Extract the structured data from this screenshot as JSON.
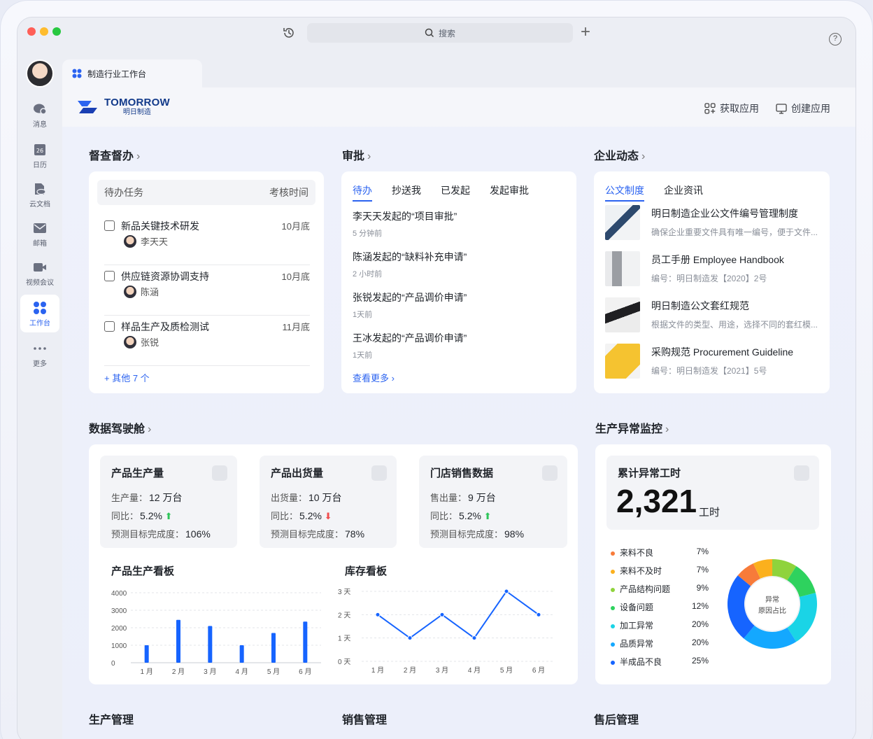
{
  "titlebar": {
    "search_placeholder": "搜索"
  },
  "rail": {
    "items": [
      {
        "label": "消息",
        "icon": "chat-icon"
      },
      {
        "label": "日历",
        "icon": "calendar-icon",
        "date": "26"
      },
      {
        "label": "云文档",
        "icon": "cloud-doc-icon"
      },
      {
        "label": "邮箱",
        "icon": "mail-icon"
      },
      {
        "label": "视频会议",
        "icon": "video-icon"
      },
      {
        "label": "工作台",
        "icon": "workspace-icon"
      },
      {
        "label": "更多",
        "icon": "more-icon"
      }
    ]
  },
  "tab": {
    "label": "制造行业工作台"
  },
  "header": {
    "logo_en": "TOMORROW",
    "logo_cn": "明日制造",
    "get_app": "获取应用",
    "create_app": "创建应用"
  },
  "supervision": {
    "title": "督查督办",
    "col_task": "待办任务",
    "col_time": "考核时间",
    "tasks": [
      {
        "name": "新品关键技术研发",
        "date": "10月底",
        "person": "李天天"
      },
      {
        "name": "供应链资源协调支持",
        "date": "10月底",
        "person": "陈涵"
      },
      {
        "name": "样品生产及质检测试",
        "date": "11月底",
        "person": "张锐"
      }
    ],
    "more": "+ 其他 7 个"
  },
  "approval": {
    "title": "审批",
    "tabs": [
      "待办",
      "抄送我",
      "已发起",
      "发起审批"
    ],
    "items": [
      {
        "title": "李天天发起的“项目审批”",
        "time": "5 分钟前"
      },
      {
        "title": "陈涵发起的“缺料补充申请”",
        "time": "2 小时前"
      },
      {
        "title": "张锐发起的“产品调价申请”",
        "time": "1天前"
      },
      {
        "title": "王冰发起的“产品调价申请”",
        "time": "1天前"
      }
    ],
    "more": "查看更多"
  },
  "news": {
    "title": "企业动态",
    "tabs": [
      "公文制度",
      "企业资讯"
    ],
    "items": [
      {
        "title": "明日制造企业公文件编号管理制度",
        "desc": "确保企业重要文件具有唯一编号，便于文件..."
      },
      {
        "title": "员工手册 Employee Handbook",
        "desc": "编号：明日制造发【2020】2号"
      },
      {
        "title": "明日制造公文套红规范",
        "desc": "根据文件的类型、用途，选择不同的套红模..."
      },
      {
        "title": "采购规范 Procurement Guideline",
        "desc": "编号：明日制造发【2021】5号"
      }
    ]
  },
  "cockpit": {
    "title": "数据驾驶舱",
    "kpis": [
      {
        "title": "产品生产量",
        "l1": "生产量：",
        "v1": "12  万台",
        "l2": "同比：",
        "v2": "5.2%",
        "trend": "up",
        "l3": "预测目标完成度：",
        "v3": "106%"
      },
      {
        "title": "产品出货量",
        "l1": "出货量：",
        "v1": "10  万台",
        "l2": "同比：",
        "v2": "5.2%",
        "trend": "down",
        "l3": "预测目标完成度：",
        "v3": "78%"
      },
      {
        "title": "门店销售数据",
        "l1": "售出量：",
        "v1": "9  万台",
        "l2": "同比：",
        "v2": "5.2%",
        "trend": "up",
        "l3": "预测目标完成度：",
        "v3": "98%"
      }
    ]
  },
  "chart_data": [
    {
      "type": "bar",
      "title": "产品生产看板",
      "categories": [
        "1 月",
        "2 月",
        "3 月",
        "4 月",
        "5 月",
        "6 月"
      ],
      "values": [
        1000,
        2450,
        2100,
        1000,
        1700,
        2350
      ],
      "yticks": [
        "4000",
        "3000",
        "2000",
        "1000",
        "0"
      ],
      "ylim": [
        0,
        4000
      ],
      "color": "#1664ff"
    },
    {
      "type": "line",
      "title": "库存看板",
      "categories": [
        "1 月",
        "2 月",
        "3 月",
        "4 月",
        "5 月",
        "6 月"
      ],
      "values": [
        2,
        1,
        2,
        1,
        3,
        2
      ],
      "yticks": [
        "3 天",
        "2 天",
        "1 天",
        "0 天"
      ],
      "ylim": [
        0,
        3
      ],
      "color": "#1664ff"
    },
    {
      "type": "pie",
      "title": "异常原因占比",
      "center_label": [
        "异常",
        "原因占比"
      ],
      "slices": [
        {
          "name": "来料不良",
          "value": 7,
          "pct": "7%",
          "color": "#f77b3a"
        },
        {
          "name": "来料不及时",
          "value": 7,
          "pct": "7%",
          "color": "#fbb01d"
        },
        {
          "name": "产品结构问题",
          "value": 9,
          "pct": "9%",
          "color": "#8fd33c"
        },
        {
          "name": "设备问题",
          "value": 12,
          "pct": "12%",
          "color": "#2ed25e"
        },
        {
          "name": "加工异常",
          "value": 20,
          "pct": "20%",
          "color": "#1ad4e6"
        },
        {
          "name": "品质异常",
          "value": 20,
          "pct": "20%",
          "color": "#14a8ff"
        },
        {
          "name": "半成品不良",
          "value": 25,
          "pct": "25%",
          "color": "#1664ff"
        }
      ]
    }
  ],
  "monitor": {
    "title": "生产异常监控",
    "label": "累计异常工时",
    "value": "2,321",
    "unit": "工时"
  },
  "bottom": {
    "s1": "生产管理",
    "s2": "销售管理",
    "s3": "售后管理"
  },
  "colors": {
    "accent": "#2b63f0",
    "up": "#2ec55a",
    "down": "#f04e4e"
  }
}
